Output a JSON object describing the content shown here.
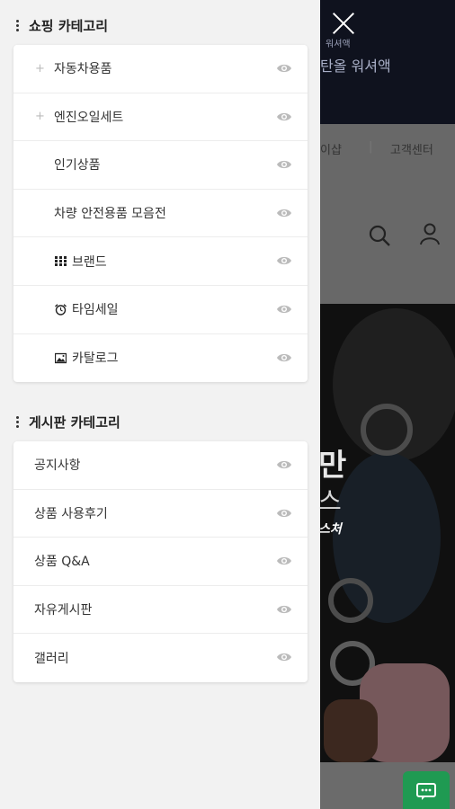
{
  "background": {
    "logo_small": "워셔액",
    "brand_text": "탄올 워셔액",
    "nav_partial": "이샵",
    "nav_separator": "|",
    "customer_center": "고객센터",
    "promo_line1": "만",
    "promo_line2": "스",
    "promo_line3": "스처",
    "colors": {
      "header": "#1c2238",
      "chat_button": "#1f9a52"
    }
  },
  "drawer": {
    "shopping_section": {
      "title": "쇼핑 카테고리",
      "items": [
        {
          "label": "자동차용품",
          "prefix": "+",
          "icon": ""
        },
        {
          "label": "엔진오일세트",
          "prefix": "+",
          "icon": ""
        },
        {
          "label": "인기상품",
          "prefix": "",
          "icon": ""
        },
        {
          "label": "차량 안전용품 모음전",
          "prefix": "",
          "icon": ""
        },
        {
          "label": "브랜드",
          "prefix": "",
          "icon": "grid-icon"
        },
        {
          "label": "타임세일",
          "prefix": "",
          "icon": "alarm-clock-icon"
        },
        {
          "label": "카탈로그",
          "prefix": "",
          "icon": "image-icon"
        }
      ]
    },
    "board_section": {
      "title": "게시판 카테고리",
      "items": [
        {
          "label": "공지사항"
        },
        {
          "label": "상품 사용후기"
        },
        {
          "label": "상품 Q&A"
        },
        {
          "label": "자유게시판"
        },
        {
          "label": "갤러리"
        }
      ]
    }
  }
}
